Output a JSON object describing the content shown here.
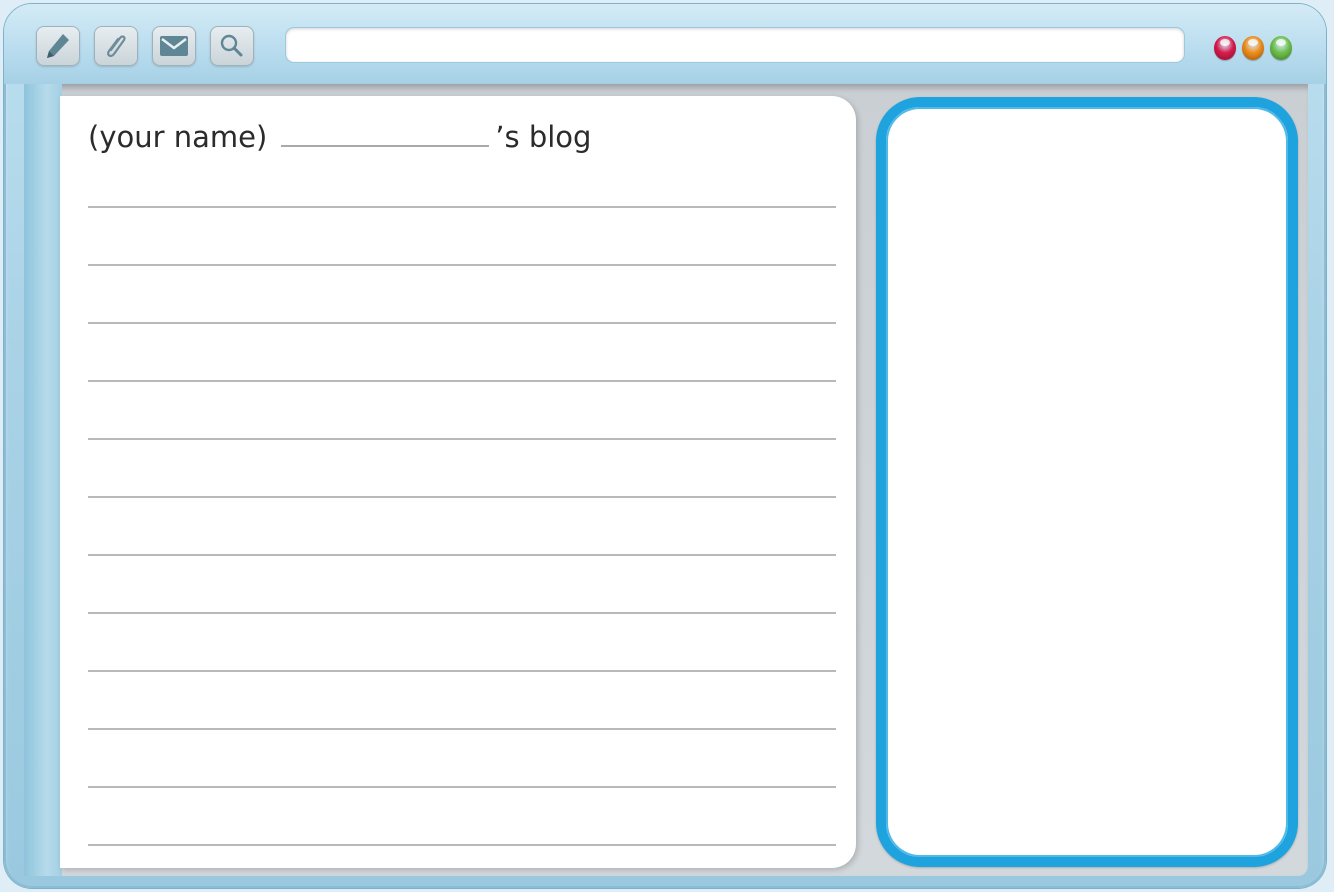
{
  "toolbar": {
    "buttons": [
      {
        "icon": "pencil-icon",
        "label": ""
      },
      {
        "icon": "paperclip-icon",
        "label": ""
      },
      {
        "icon": "envelope-icon",
        "label": ""
      },
      {
        "icon": "magnifier-icon",
        "label": ""
      }
    ],
    "address_bar": {
      "value": "",
      "placeholder": ""
    }
  },
  "window_controls": {
    "colors": [
      "#d81b4c",
      "#f08c1a",
      "#6cc04a"
    ]
  },
  "blog": {
    "title_prefix": "(your name)",
    "title_suffix": "’s blog",
    "ruled_line_count": 12
  },
  "image_panel": {
    "accent_color": "#1ea3de"
  }
}
